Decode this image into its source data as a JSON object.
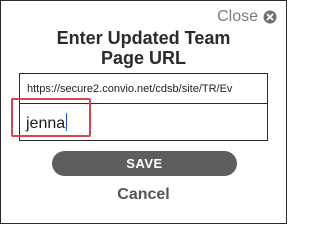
{
  "dialog": {
    "close_label": "Close",
    "title_line1": "Enter Updated Team",
    "title_line2": "Page URL",
    "url_value": "https://secure2.convio.net/cdsb/site/TR/Ev",
    "name_value": "jenna",
    "save_label": "SAVE",
    "cancel_label": "Cancel"
  },
  "colors": {
    "highlight": "#d9434b",
    "save_button": "#5e5e5e",
    "caret": "#1f4fd8"
  }
}
